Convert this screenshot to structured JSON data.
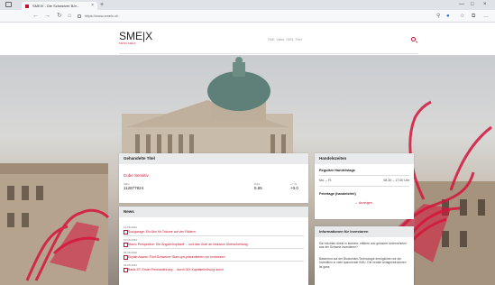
{
  "browser": {
    "tab_title": "SMEIX - Die Schweizer Bör...",
    "tab_close": "×",
    "new_tab": "+",
    "url": "https://www.smeix.ch",
    "window_controls": [
      "—",
      "□",
      "×"
    ]
  },
  "site": {
    "logo": "SME|X",
    "logo_sub": "SWISS SMEIX",
    "search_placeholder": "SMI, Valor, ISIN, Titel"
  },
  "traded_titles": {
    "heading": "Gehandelte Titel",
    "title_link": "Cube Sensitiv",
    "col1_label": "Valor",
    "col1_value": "112877924",
    "col2_label": "Kurs",
    "col2_value": "5.65",
    "col3_label": "+/- %",
    "col3_value": "+0.0"
  },
  "news": {
    "heading": "News",
    "items": [
      {
        "date": "12.08.2022",
        "title": "Soulgarage: Ein Abo für Träume auf vier Rädern"
      },
      {
        "date": "10.08.2022",
        "title": "Macro Perspective: Die Ängste/Impfstoff ... und das Gute an Inklusion Überschreitung"
      },
      {
        "date": "06.08.2022",
        "title": "Skylab Assets: Fünf Schweizer Start-ups präsentierten vor Investoren"
      },
      {
        "date": "03.08.2022",
        "title": "Basis ST: Erster Fremdwährung ... durch SIX Kapitalerhöhung durch"
      }
    ]
  },
  "trading_hours": {
    "heading": "Handelszeiten",
    "regular_label": "Reguläre Handelstage",
    "regular_days": "Mo. – Fr.",
    "regular_time": "08.30 – 17.00 Uhr",
    "holidays_label": "Feiertage (handelsfrei)",
    "show_more": "Anzeigen"
  },
  "investors": {
    "heading": "Informationen für Investoren",
    "paragraph1": "Sie möchten direkt in kleinere, mittlere und grössere Unternehmen aus der Schweiz investieren?",
    "paragraph2": "Basierend auf der Blockchain-Technologie ermöglichen wir die Investition in viele spannende KMU. Die neuste Anlagenstrukturen ist ganz"
  },
  "colors": {
    "brand_red": "#c4122f",
    "card_header": "#e9eaec"
  }
}
